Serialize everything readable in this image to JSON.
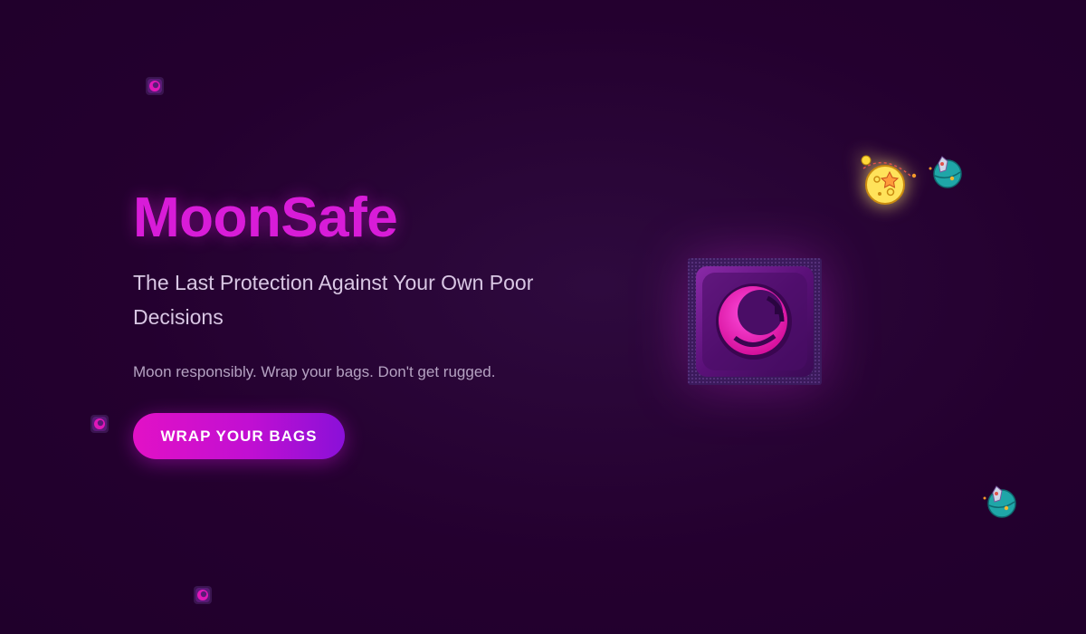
{
  "hero": {
    "title": "MoonSafe",
    "tagline": "The Last Protection Against Your Own Poor Decisions",
    "subtext": "Moon responsibly. Wrap your bags. Don't get rugged.",
    "cta_label": "WRAP YOUR BAGS"
  },
  "decorations": {
    "main_icon": "condom-packet-icon",
    "moon_icon": "moon-icon",
    "planet_icon": "planet-rocket-icon",
    "mini_icon": "mini-condom-packet-icon"
  },
  "colors": {
    "background": "#24002f",
    "title": "#d81cd8",
    "accent_pink": "#e617c8",
    "accent_purple": "#8a10d8",
    "tagline": "#d9c7e4",
    "subtext": "#b5a2c2"
  }
}
